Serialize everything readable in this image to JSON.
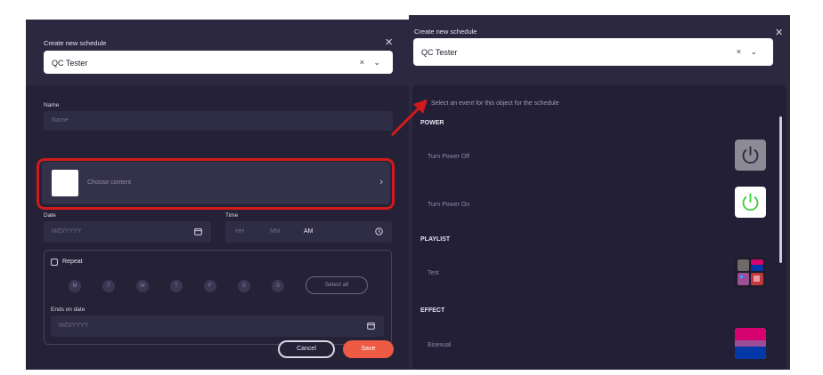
{
  "left_dialog": {
    "title": "Create new schedule",
    "close_icon": "close-icon",
    "device_select": {
      "value": "QC Tester",
      "controls": "× ⌄"
    },
    "name_label": "Name",
    "name_placeholder": "Name",
    "content_picker_label": "Choose content",
    "date_label": "Date",
    "date_placeholder": "M/D/YYYY",
    "time_label": "Time",
    "time_hour": "HH",
    "time_separator": ":",
    "time_minute": "MM",
    "time_ampm": "AM",
    "repeat_label": "Repeat",
    "days": [
      "M",
      "T",
      "W",
      "T",
      "F",
      "S",
      "S"
    ],
    "select_all": "Select all",
    "ends_on_label": "Ends on date",
    "ends_on_placeholder": "M/D/YYYY",
    "cancel": "Cancel",
    "save": "Save"
  },
  "right_dialog": {
    "title": "Create new schedule",
    "device_select": {
      "value": "QC Tester",
      "controls": "× ⌄"
    },
    "hint": "Select an event for this object for the schedule",
    "sections": [
      {
        "name": "POWER",
        "items": [
          {
            "label": "Turn Power Off",
            "icon": "power-off-icon"
          },
          {
            "label": "Turn Power On",
            "icon": "power-on-icon"
          }
        ]
      },
      {
        "name": "PLAYLIST",
        "items": [
          {
            "label": "Test",
            "icon": "playlist-thumbnail"
          }
        ]
      },
      {
        "name": "EFFECT",
        "items": [
          {
            "label": "Bisexual",
            "icon": "bisexual-flag-effect"
          }
        ]
      }
    ]
  },
  "colors": {
    "panel": "#2b2840",
    "save": "#ee5b45",
    "highlight": "#d31a1a",
    "power_on_green": "#3ec93a",
    "flag_pink": "#d60270",
    "flag_purple": "#9b4f96",
    "flag_blue": "#0038a8"
  }
}
